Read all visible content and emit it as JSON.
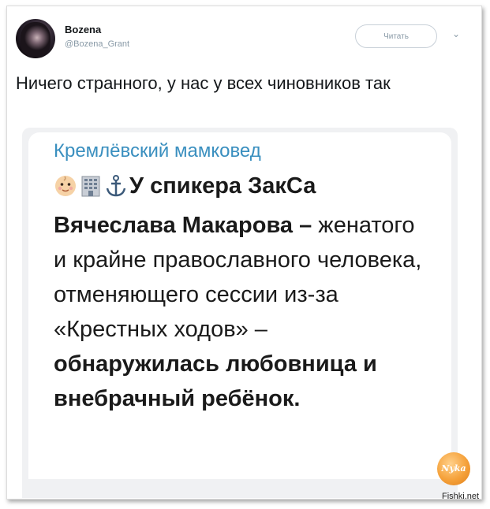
{
  "tweet": {
    "author_name": "Bozena",
    "author_handle": "@Bozena_Grant",
    "follow_label": "Читать",
    "text": "Ничего странного, у нас у всех чиновников так"
  },
  "embedded_post": {
    "channel_name": "Кремлёвский мамковед",
    "emojis": [
      "baby-face",
      "office-building",
      "anchor"
    ],
    "text_bold_1": "У спикера ЗакСа Вячеслава Макарова –",
    "text_regular": "женатого и крайне православного человека, отменяющего сессии из-за «Крестных ходов» –",
    "text_bold_2": "обнаружилась любовница и внебрачный ребёнок."
  },
  "watermark": {
    "logo_text": "Nyka",
    "site": "Fishki.net"
  },
  "colors": {
    "channel_link": "#3a8fbf",
    "handle": "#8899a6",
    "watermark_orange": "#f5a13a"
  }
}
